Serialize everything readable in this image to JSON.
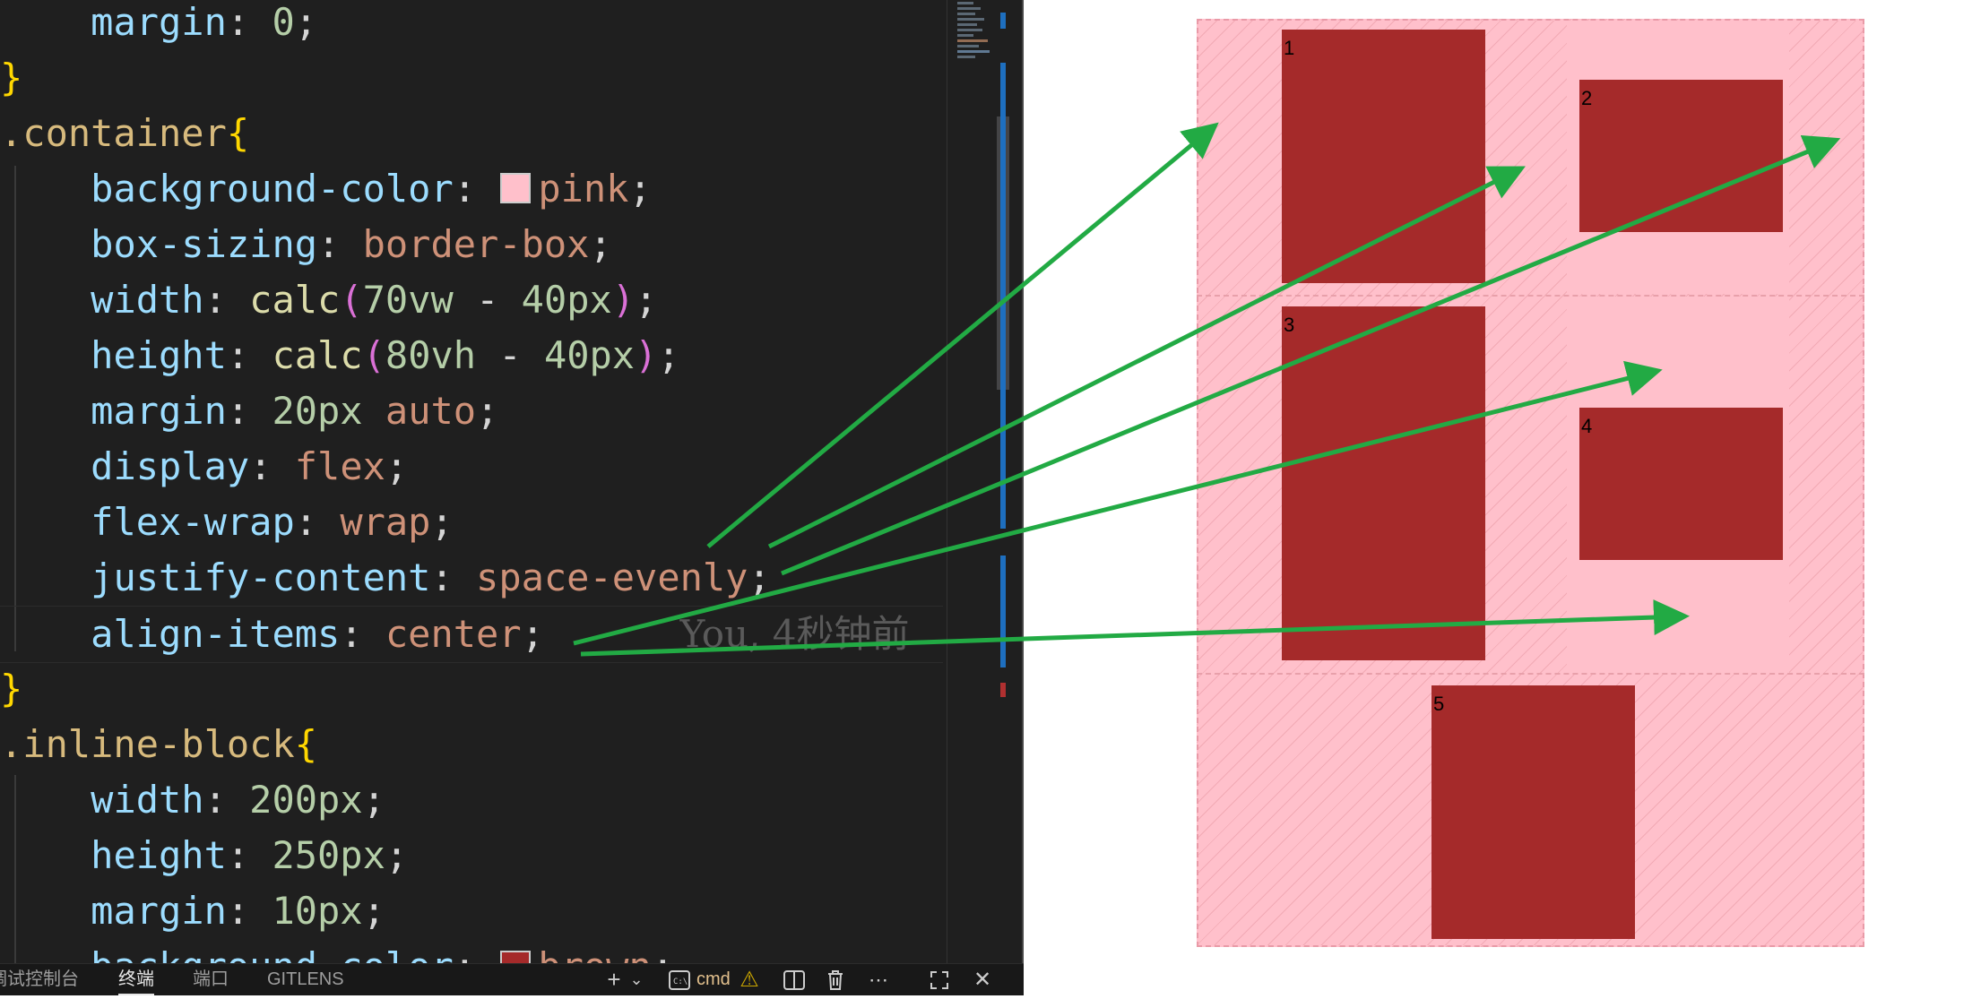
{
  "editor": {
    "line0": {
      "prop": "margin",
      "value": "0"
    },
    "close_brace_1": "}",
    "container_selector": ".container",
    "open_brace": "{",
    "bg": {
      "prop": "background-color",
      "value": "pink",
      "swatch_color": "#ffc0cb"
    },
    "boxsizing": {
      "prop": "box-sizing",
      "value": "border-box"
    },
    "width": {
      "prop": "width",
      "fn": "calc",
      "a": "70vw",
      "op": "-",
      "b": "40px"
    },
    "height": {
      "prop": "height",
      "fn": "calc",
      "a": "80vh",
      "op": "-",
      "b": "40px"
    },
    "margin": {
      "prop": "margin",
      "num": "20px",
      "kw": "auto"
    },
    "display": {
      "prop": "display",
      "value": "flex"
    },
    "flexwrap": {
      "prop": "flex-wrap",
      "value": "wrap"
    },
    "justify": {
      "prop": "justify-content",
      "value": "space-evenly"
    },
    "align": {
      "prop": "align-items",
      "value": "center",
      "blame": "You, 4秒钟前"
    },
    "close_brace_2": "}",
    "inline_selector": ".inline-block",
    "ib_width": {
      "prop": "width",
      "value": "200px"
    },
    "ib_height": {
      "prop": "height",
      "value": "250px"
    },
    "ib_margin": {
      "prop": "margin",
      "value": "10px"
    },
    "ib_bg": {
      "prop": "background-color",
      "value": "brown",
      "swatch_color": "#a52a2a"
    }
  },
  "panel": {
    "tabs": [
      "调试控制台",
      "终端",
      "端口",
      "GITLENS"
    ],
    "active_tab": "终端",
    "terminal_name": "cmd",
    "icons": [
      "plus-icon",
      "chevron-down-icon",
      "terminal-icon",
      "warning-icon",
      "split-icon",
      "trash-icon",
      "more-icon",
      "maximize-icon",
      "close-icon"
    ]
  },
  "preview": {
    "container_color": "#ffc0cb",
    "box_color": "#a52a2a",
    "boxes": [
      "1",
      "2",
      "3",
      "4",
      "5"
    ]
  },
  "annotation": {
    "arrow_color": "#22aa44"
  }
}
